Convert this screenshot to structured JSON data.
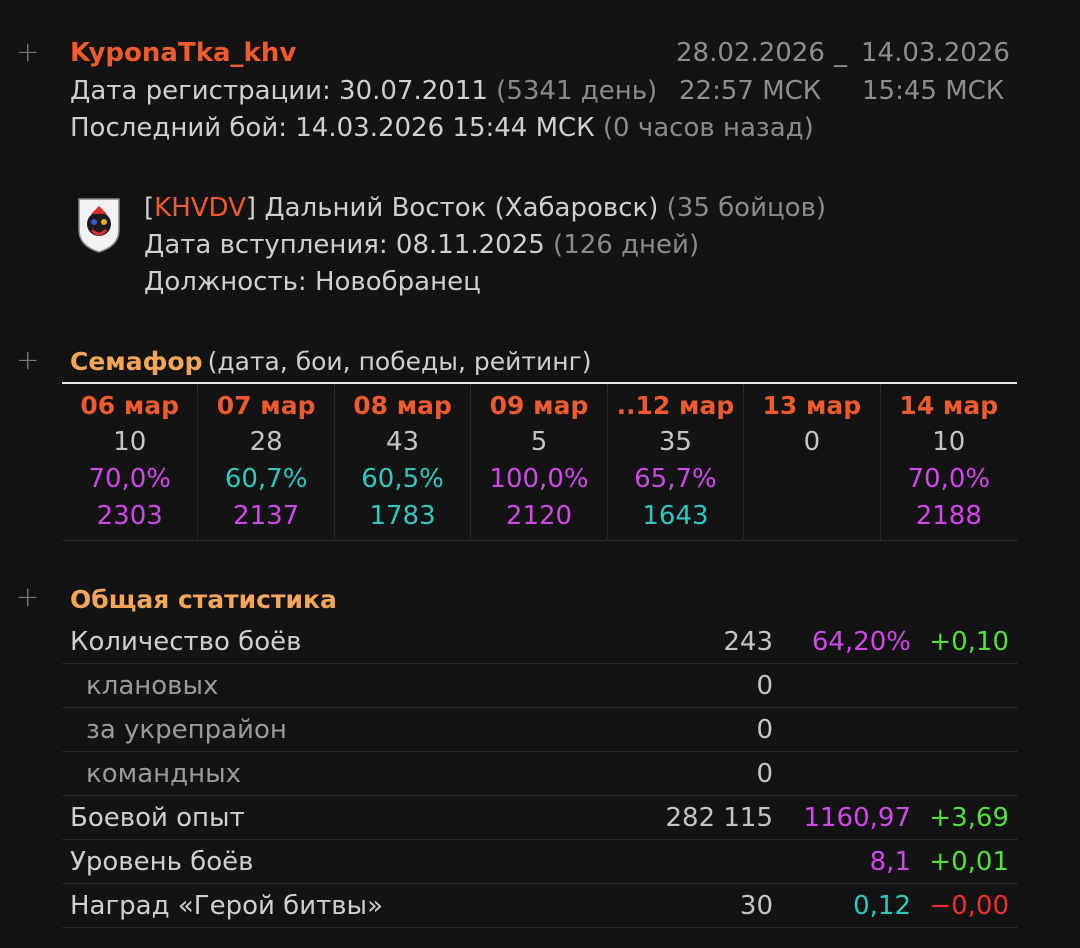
{
  "player": {
    "nickname": "KyponaTka_khv",
    "reg_label": "Дата регистрации: 30.07.2011",
    "reg_days": "(5341 день)",
    "last_battle_label": "Последний бой: 14.03.2026 15:44 МСК",
    "last_battle_ago": "(0 часов назад)",
    "range_start_date": "28.02.2026",
    "range_sep": "_",
    "range_end_date": "14.03.2026",
    "range_start_time": "22:57 МСК",
    "range_end_time": "15:45 МСК"
  },
  "clan": {
    "bracket_open": "[",
    "tag": "KHVDV",
    "bracket_close": "]",
    "name": "Дальний Восток (Хабаровск)",
    "members": "(35 бойцов)",
    "join_label": "Дата вступления: 08.11.2025",
    "join_days": "(126 дней)",
    "position": "Должность: Новобранец"
  },
  "semafor": {
    "title": "Семафор",
    "subtitle": "(дата, бои, победы, рейтинг)",
    "days": [
      {
        "date": "06 мар",
        "battles": "10",
        "winrate": "70,0%",
        "wr_color": "mag",
        "rating": "2303",
        "rt_color": "mag"
      },
      {
        "date": "07 мар",
        "battles": "28",
        "winrate": "60,7%",
        "wr_color": "cyan",
        "rating": "2137",
        "rt_color": "mag"
      },
      {
        "date": "08 мар",
        "battles": "43",
        "winrate": "60,5%",
        "wr_color": "cyan",
        "rating": "1783",
        "rt_color": "cyan"
      },
      {
        "date": "09 мар",
        "battles": "5",
        "winrate": "100,0%",
        "wr_color": "mag",
        "rating": "2120",
        "rt_color": "mag"
      },
      {
        "date": "..12 мар",
        "battles": "35",
        "winrate": "65,7%",
        "wr_color": "mag",
        "rating": "1643",
        "rt_color": "cyan"
      },
      {
        "date": "13 мар",
        "battles": "0",
        "winrate": "",
        "wr_color": "mag",
        "rating": "",
        "rt_color": "mag"
      },
      {
        "date": "14 мар",
        "battles": "10",
        "winrate": "70,0%",
        "wr_color": "mag",
        "rating": "2188",
        "rt_color": "mag"
      }
    ]
  },
  "stats": {
    "title": "Общая статистика",
    "rows": [
      {
        "label": "Количество боёв",
        "sub": false,
        "v1": "243",
        "v2": "64,20%",
        "v2_color": "mag",
        "v3": "+0,10",
        "v3_color": "green"
      },
      {
        "label": "клановых",
        "sub": true,
        "v1": "0",
        "v2": "",
        "v2_color": "mag",
        "v3": "",
        "v3_color": "green"
      },
      {
        "label": "за укрепрайон",
        "sub": true,
        "v1": "0",
        "v2": "",
        "v2_color": "mag",
        "v3": "",
        "v3_color": "green"
      },
      {
        "label": "командных",
        "sub": true,
        "v1": "0",
        "v2": "",
        "v2_color": "mag",
        "v3": "",
        "v3_color": "green"
      },
      {
        "label": "Боевой опыт",
        "sub": false,
        "v1": "282 115",
        "v2": "1160,97",
        "v2_color": "mag",
        "v3": "+3,69",
        "v3_color": "green"
      },
      {
        "label": "Уровень боёв",
        "sub": false,
        "v1": "",
        "v2": "8,1",
        "v2_color": "mag",
        "v3": "+0,01",
        "v3_color": "green"
      },
      {
        "label": "Наград «Герой битвы»",
        "sub": false,
        "v1": "30",
        "v2": "0,12",
        "v2_color": "cyan",
        "v3": "−0,00",
        "v3_color": "red"
      }
    ]
  },
  "icons": {
    "expand": "plus-icon",
    "clan_emblem": "clan-emblem-icon"
  },
  "colors": {
    "accent": "#ef5a2f",
    "header": "#f5a65b",
    "magenta": "#d048e8",
    "cyan": "#2ec8c0",
    "green": "#55e040",
    "red": "#ef3030"
  }
}
